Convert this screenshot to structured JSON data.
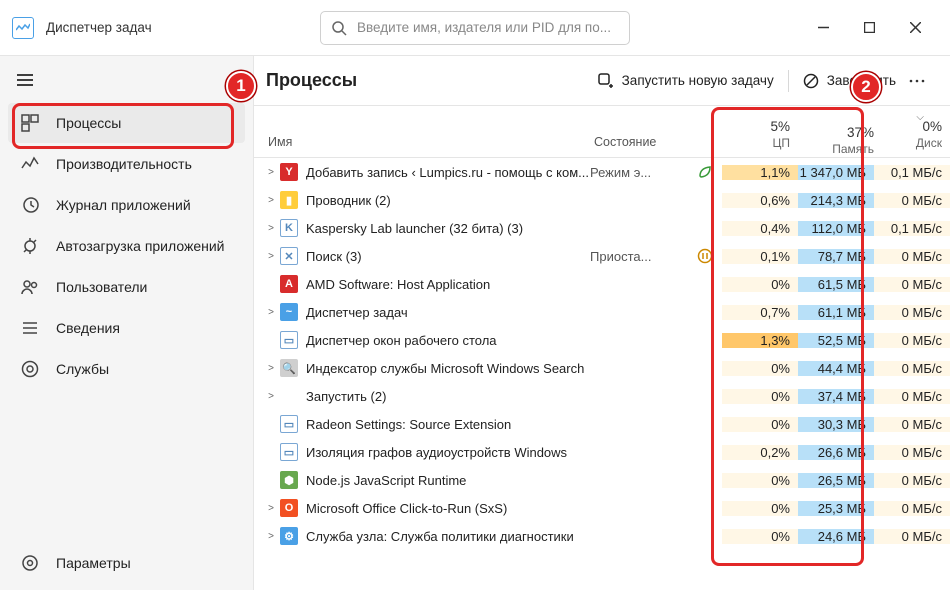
{
  "app": {
    "title": "Диспетчер задач"
  },
  "search": {
    "placeholder": "Введите имя, издателя или PID для по..."
  },
  "sidebar": {
    "items": [
      {
        "label": "Процессы",
        "icon": "processes"
      },
      {
        "label": "Производительность",
        "icon": "performance"
      },
      {
        "label": "Журнал приложений",
        "icon": "history"
      },
      {
        "label": "Автозагрузка приложений",
        "icon": "startup"
      },
      {
        "label": "Пользователи",
        "icon": "users"
      },
      {
        "label": "Сведения",
        "icon": "details"
      },
      {
        "label": "Службы",
        "icon": "services"
      }
    ],
    "settings": "Параметры"
  },
  "page": {
    "title": "Процессы",
    "run_new": "Запустить новую задачу",
    "end_task": "Завершить"
  },
  "columns": {
    "name": "Имя",
    "state": "Состояние",
    "cpu": {
      "pct": "5%",
      "label": "ЦП"
    },
    "mem": {
      "pct": "37%",
      "label": "Память"
    },
    "disk": {
      "pct": "0%",
      "label": "Диск"
    }
  },
  "rows": [
    {
      "exp": ">",
      "icon_bg": "#d82c2c",
      "icon_txt": "Y",
      "name": "Добавить запись ‹ Lumpics.ru - помощь с ком...",
      "state": "Режим э...",
      "state_icon": "leaf",
      "cpu": "1,1%",
      "cpu_h": "mid",
      "mem": "1 347,0 МБ",
      "disk": "0,1 МБ/с"
    },
    {
      "exp": ">",
      "icon_bg": "#ffcd3c",
      "icon_txt": "▮",
      "name": "Проводник (2)",
      "state": "",
      "state_icon": "",
      "cpu": "0,6%",
      "cpu_h": "lite",
      "mem": "214,3 МБ",
      "disk": "0 МБ/с"
    },
    {
      "exp": ">",
      "icon_bg": "#ffffff",
      "icon_txt": "K",
      "name": "Kaspersky Lab launcher (32 бита) (3)",
      "state": "",
      "state_icon": "",
      "cpu": "0,4%",
      "cpu_h": "lite",
      "mem": "112,0 МБ",
      "disk": "0,1 МБ/с"
    },
    {
      "exp": ">",
      "icon_bg": "#ffffff",
      "icon_txt": "✕",
      "name": "Поиск (3)",
      "state": "Приоста...",
      "state_icon": "pause",
      "cpu": "0,1%",
      "cpu_h": "lite",
      "mem": "78,7 МБ",
      "disk": "0 МБ/с"
    },
    {
      "exp": "",
      "icon_bg": "#d82c2c",
      "icon_txt": "A",
      "name": "AMD Software: Host Application",
      "state": "",
      "state_icon": "",
      "cpu": "0%",
      "cpu_h": "lite",
      "mem": "61,5 МБ",
      "disk": "0 МБ/с"
    },
    {
      "exp": ">",
      "icon_bg": "#4aa0e6",
      "icon_txt": "~",
      "name": "Диспетчер задач",
      "state": "",
      "state_icon": "",
      "cpu": "0,7%",
      "cpu_h": "lite",
      "mem": "61,1 МБ",
      "disk": "0 МБ/с"
    },
    {
      "exp": "",
      "icon_bg": "#ffffff",
      "icon_txt": "▭",
      "name": "Диспетчер окон рабочего стола",
      "state": "",
      "state_icon": "",
      "cpu": "1,3%",
      "cpu_h": "hi",
      "mem": "52,5 МБ",
      "disk": "0 МБ/с"
    },
    {
      "exp": ">",
      "icon_bg": "#cfcfcf",
      "icon_txt": "🔍",
      "name": "Индексатор службы Microsoft Windows Search",
      "state": "",
      "state_icon": "",
      "cpu": "0%",
      "cpu_h": "lite",
      "mem": "44,4 МБ",
      "disk": "0 МБ/с"
    },
    {
      "exp": ">",
      "icon_bg": "transparent",
      "icon_txt": "",
      "name": "Запустить (2)",
      "state": "",
      "state_icon": "",
      "cpu": "0%",
      "cpu_h": "lite",
      "mem": "37,4 МБ",
      "disk": "0 МБ/с"
    },
    {
      "exp": "",
      "icon_bg": "#ffffff",
      "icon_txt": "▭",
      "name": "Radeon Settings: Source Extension",
      "state": "",
      "state_icon": "",
      "cpu": "0%",
      "cpu_h": "lite",
      "mem": "30,3 МБ",
      "disk": "0 МБ/с"
    },
    {
      "exp": "",
      "icon_bg": "#ffffff",
      "icon_txt": "▭",
      "name": "Изоляция графов аудиоустройств Windows",
      "state": "",
      "state_icon": "",
      "cpu": "0,2%",
      "cpu_h": "lite",
      "mem": "26,6 МБ",
      "disk": "0 МБ/с"
    },
    {
      "exp": "",
      "icon_bg": "#68a84f",
      "icon_txt": "⬢",
      "name": "Node.js JavaScript Runtime",
      "state": "",
      "state_icon": "",
      "cpu": "0%",
      "cpu_h": "lite",
      "mem": "26,5 МБ",
      "disk": "0 МБ/с"
    },
    {
      "exp": ">",
      "icon_bg": "#f25022",
      "icon_txt": "O",
      "name": "Microsoft Office Click-to-Run (SxS)",
      "state": "",
      "state_icon": "",
      "cpu": "0%",
      "cpu_h": "lite",
      "mem": "25,3 МБ",
      "disk": "0 МБ/с"
    },
    {
      "exp": ">",
      "icon_bg": "#4aa0e6",
      "icon_txt": "⚙",
      "name": "Служба узла: Служба политики диагностики",
      "state": "",
      "state_icon": "",
      "cpu": "0%",
      "cpu_h": "lite",
      "mem": "24,6 МБ",
      "disk": "0 МБ/с"
    }
  ]
}
